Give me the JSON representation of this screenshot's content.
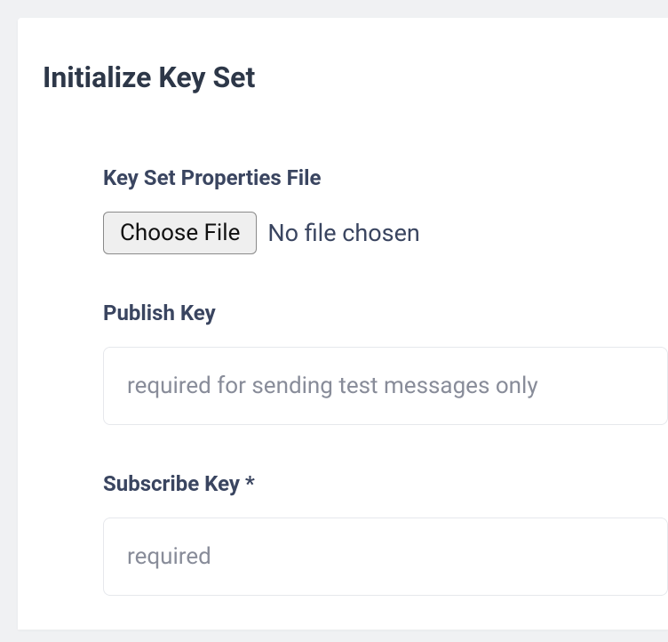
{
  "page": {
    "title": "Initialize Key Set"
  },
  "form": {
    "file": {
      "label": "Key Set Properties File",
      "button": "Choose File",
      "status": "No file chosen"
    },
    "publishKey": {
      "label": "Publish Key",
      "placeholder": "required for sending test messages only",
      "value": ""
    },
    "subscribeKey": {
      "label": "Subscribe Key *",
      "placeholder": "required",
      "value": ""
    }
  }
}
